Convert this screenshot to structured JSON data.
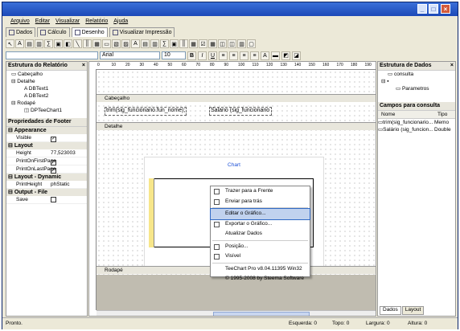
{
  "menu": [
    "Arquivo",
    "Editar",
    "Visualizar",
    "Relatório",
    "Ajuda"
  ],
  "tabs": [
    "Dados",
    "Cálculo",
    "Desenho",
    "Visualizar Impressão"
  ],
  "toolbar2": {
    "font": "Arial",
    "size": "10"
  },
  "left_pane": {
    "title": "Estrutura do Relatório",
    "tree": [
      "Cabeçalho",
      "Detalhe",
      "DBText1",
      "DBText2",
      "Rodapé",
      "DPTeeChart1"
    ],
    "props_title": "Propriedades de Footer",
    "props": [
      {
        "cat": "Appearance"
      },
      {
        "k": "Visible",
        "v": "✓"
      },
      {
        "cat": "Layout"
      },
      {
        "k": "Height",
        "v": "77,523003"
      },
      {
        "k": "PrintOnFirstPage",
        "v": "✓"
      },
      {
        "k": "PrintOnLastPage",
        "v": "✓"
      },
      {
        "cat": "Layout - Dynamic"
      },
      {
        "k": "PrintHeight",
        "v": "phStatic"
      },
      {
        "cat": "Output - File"
      },
      {
        "k": "Save",
        "v": ""
      }
    ]
  },
  "design": {
    "ruler": [
      "0",
      "10",
      "20",
      "30",
      "40",
      "50",
      "60",
      "70",
      "80",
      "90",
      "100",
      "110",
      "120",
      "130",
      "140",
      "150",
      "160",
      "170",
      "180",
      "190"
    ],
    "bands": {
      "header": "Cabeçalho",
      "detail": "Detalhe",
      "footer": "Rodapé"
    },
    "field1": "trim(sig_funcionario.fun_nome);",
    "field2": "Salário (sig_funcionario",
    "chart_title": "Chart"
  },
  "context_menu": {
    "items": [
      "Trazer para a Frente",
      "Enviar para trás",
      "Editar o Gráfico...",
      "Exportar o Gráfico...",
      "Atualizar Dados",
      "Posição...",
      "Visível",
      "TeeChart Pro v8.04.11395 Win32",
      "© 1995-2008 by Steema Software"
    ]
  },
  "right_pane": {
    "title": "Estrutura de Dados",
    "tree": [
      "consulta",
      "Parametros"
    ],
    "campos_title": "Campos para consulta",
    "columns": [
      "Nome",
      "Tipo"
    ],
    "rows": [
      {
        "n": "trim(sig_funcionario...",
        "t": "Memo"
      },
      {
        "n": "Salário (sig_funcion...",
        "t": "Double"
      }
    ],
    "tabs": [
      "Dados",
      "Layout"
    ]
  },
  "status": {
    "left": "Pronto.",
    "esquerda": "Esquerda: 0",
    "topo": "Topo: 0",
    "largura": "Largura: 0",
    "altura": "Altura: 0"
  }
}
